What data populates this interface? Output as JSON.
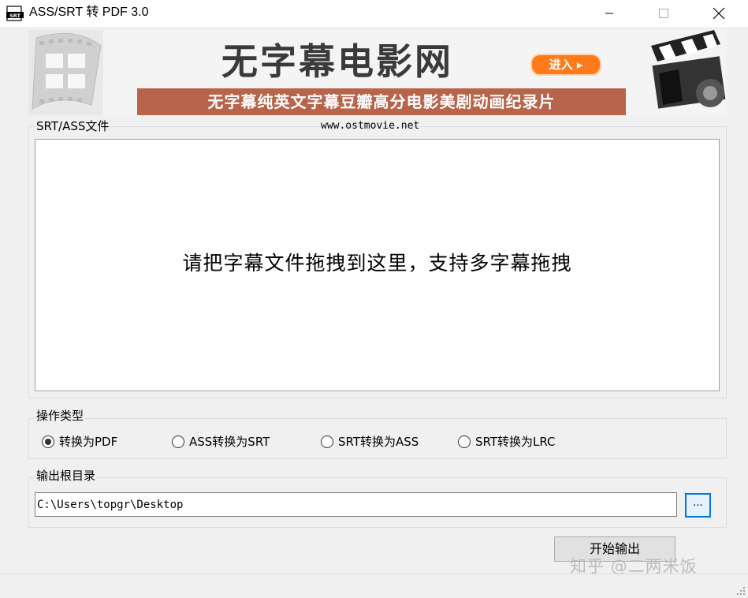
{
  "window": {
    "title": "ASS/SRT 转 PDF 3.0",
    "icon_text": "SRT"
  },
  "banner": {
    "title": "无字幕电影网",
    "enter_label": "进入 ▸",
    "tagline": "无字幕纯英文字幕豆瓣高分电影美剧动画纪录片",
    "url": "www.ostmovie.net"
  },
  "subtitle_group": {
    "label": "SRT/ASS文件",
    "drop_hint": "请把字幕文件拖拽到这里，支持多字幕拖拽"
  },
  "operation_group": {
    "label": "操作类型",
    "options": [
      {
        "label": "转换为PDF",
        "checked": true
      },
      {
        "label": "ASS转换为SRT",
        "checked": false
      },
      {
        "label": "SRT转换为ASS",
        "checked": false
      },
      {
        "label": "SRT转换为LRC",
        "checked": false
      }
    ]
  },
  "output_group": {
    "label": "输出根目录",
    "path_value": "C:\\Users\\topgr\\Desktop",
    "browse_label": "..."
  },
  "actions": {
    "start_label": "开始输出"
  },
  "watermark": "知乎 @二两米饭",
  "colors": {
    "accent": "#0078d7",
    "banner_strip": "#b7644a",
    "enter_button": "#ff7a1a"
  }
}
